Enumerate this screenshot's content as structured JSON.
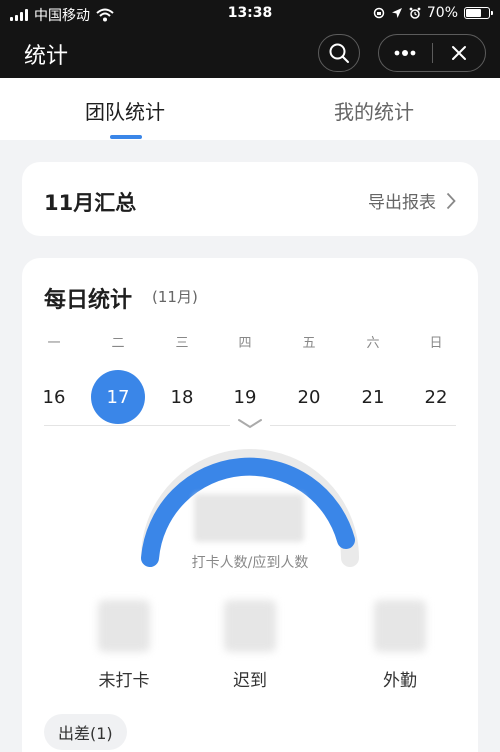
{
  "status_bar": {
    "carrier": "中国移动",
    "time": "13:38",
    "battery": "70%",
    "battery_level": 0.7
  },
  "nav": {
    "title": "统计",
    "icons": [
      "search-icon",
      "more-icon",
      "close-icon"
    ]
  },
  "tabs": [
    {
      "label": "团队统计",
      "active": true
    },
    {
      "label": "我的统计",
      "active": false
    }
  ],
  "summary": {
    "title": "11月汇总",
    "export_label": "导出报表"
  },
  "daily": {
    "title": "每日统计",
    "month": "(11月)",
    "weekdays": [
      "一",
      "二",
      "三",
      "四",
      "五",
      "六",
      "日"
    ],
    "dates": [
      "16",
      "17",
      "18",
      "19",
      "20",
      "21",
      "22"
    ],
    "selected_date": "17"
  },
  "gauge": {
    "value": "",
    "label": "打卡人数/应到人数",
    "color": "#3a86e8"
  },
  "stats": [
    {
      "label": "未打卡",
      "value": ""
    },
    {
      "label": "迟到",
      "value": ""
    },
    {
      "label": "外勤",
      "value": ""
    }
  ],
  "chips": [
    {
      "label": "出差(1)"
    }
  ]
}
